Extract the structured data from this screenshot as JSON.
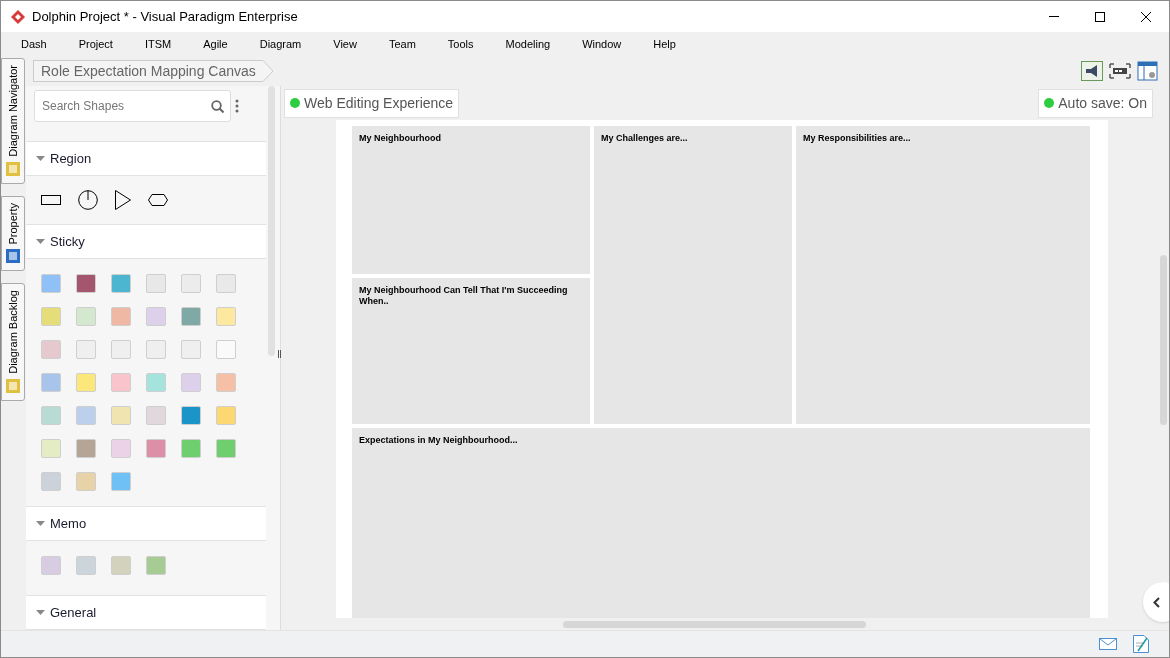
{
  "window": {
    "title": "Dolphin Project * - Visual Paradigm Enterprise"
  },
  "menu": [
    "Dash",
    "Project",
    "ITSM",
    "Agile",
    "Diagram",
    "View",
    "Team",
    "Tools",
    "Modeling",
    "Window",
    "Help"
  ],
  "side_tabs": [
    {
      "label": "Diagram Navigator"
    },
    {
      "label": "Property"
    },
    {
      "label": "Diagram Backlog"
    }
  ],
  "breadcrumb": "Role Expectation Mapping Canvas",
  "search": {
    "placeholder": "Search Shapes"
  },
  "palette": [
    {
      "title": "Region",
      "expanded": true,
      "kind": "region"
    },
    {
      "title": "Sticky",
      "expanded": true,
      "kind": "sticky"
    },
    {
      "title": "Memo",
      "expanded": true,
      "kind": "memo"
    },
    {
      "title": "General",
      "expanded": true,
      "kind": "none"
    }
  ],
  "web_editing": {
    "label": "Web Editing Experience"
  },
  "auto_save": {
    "label": "Auto save: On"
  },
  "canvas_cells": [
    {
      "title": "My Neighbourhood"
    },
    {
      "title": "My Challenges are..."
    },
    {
      "title": "My Responsibilities are..."
    },
    {
      "title": "My Neighbourhood Can Tell That I'm Succeeding When.."
    },
    {
      "title": "Expectations in My Neighbourhood..."
    }
  ]
}
